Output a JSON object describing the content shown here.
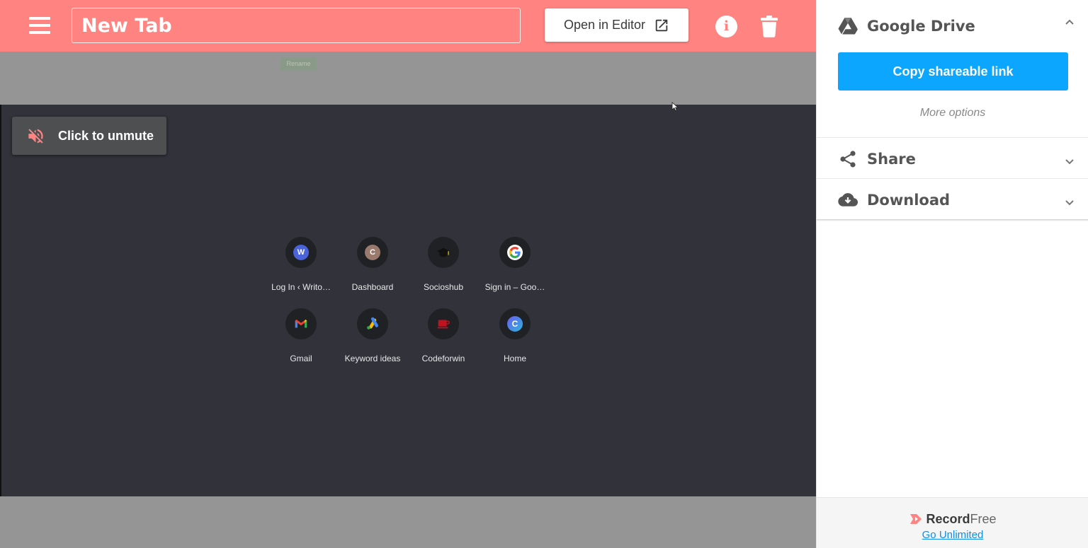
{
  "header": {
    "title": "New Tab",
    "open_editor_label": "Open in Editor",
    "rename_tooltip": "Rename"
  },
  "video": {
    "unmute_label": "Click to unmute",
    "shortcuts": [
      {
        "label": "Log In ‹ Writo…",
        "icon": "writo-favicon"
      },
      {
        "label": "Dashboard",
        "icon": "dashboard-favicon"
      },
      {
        "label": "Socioshub",
        "icon": "socioshub-favicon"
      },
      {
        "label": "Sign in – Goo…",
        "icon": "google-favicon"
      },
      {
        "label": "Gmail",
        "icon": "gmail-favicon"
      },
      {
        "label": "Keyword ideas",
        "icon": "google-ads-favicon"
      },
      {
        "label": "Codeforwin",
        "icon": "codeforwin-favicon"
      },
      {
        "label": "Home",
        "icon": "home-favicon"
      }
    ]
  },
  "sidebar": {
    "google_drive": {
      "title": "Google Drive",
      "copy_link_label": "Copy shareable link",
      "more_options_label": "More options"
    },
    "share": {
      "title": "Share"
    },
    "download": {
      "title": "Download"
    }
  },
  "footer": {
    "brand_bold": "Record",
    "brand_light": "Free",
    "go_unlimited": "Go Unlimited"
  },
  "colors": {
    "header_bg": "#ff8381",
    "accent_blue": "#0da6ff",
    "video_bg": "#31323a"
  }
}
